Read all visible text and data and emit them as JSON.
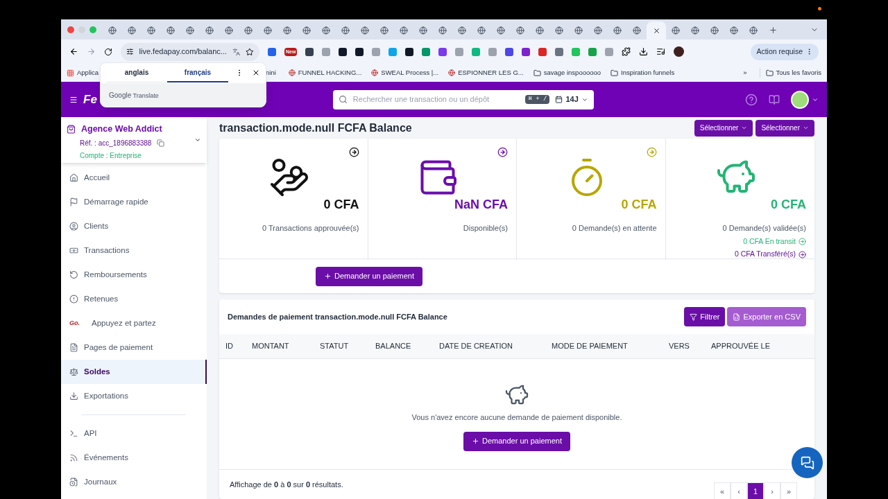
{
  "browser": {
    "tabs": [
      {
        "selected": false
      },
      {
        "selected": false
      },
      {
        "selected": false
      },
      {
        "selected": false
      },
      {
        "selected": false
      },
      {
        "selected": false
      },
      {
        "selected": false
      },
      {
        "selected": false
      },
      {
        "selected": false
      },
      {
        "selected": false
      },
      {
        "selected": false
      },
      {
        "selected": false
      },
      {
        "selected": false
      },
      {
        "selected": false
      },
      {
        "selected": false
      },
      {
        "selected": false
      },
      {
        "selected": false
      },
      {
        "selected": false
      },
      {
        "selected": false
      },
      {
        "selected": false
      },
      {
        "selected": false
      },
      {
        "selected": false
      },
      {
        "selected": false
      },
      {
        "selected": false
      },
      {
        "selected": false
      },
      {
        "selected": false
      },
      {
        "selected": false
      },
      {
        "selected": false
      },
      {
        "selected": true
      },
      {
        "selected": false
      },
      {
        "selected": false
      },
      {
        "selected": false
      },
      {
        "selected": false
      },
      {
        "selected": false
      }
    ],
    "address": "live.fedapay.com/balanc...",
    "extension_badge": "New",
    "action_button": "Action requise",
    "bookmarks": [
      "Applica",
      "nini",
      "FUNNEL HACKING...",
      "SWEAL Process |...",
      "ESPIONNER LES G...",
      "savage inspoooooo",
      "Inspiration funnels"
    ],
    "bookmarks_more": "»",
    "all_bookmarks": "Tous les favoris",
    "translate_popup": {
      "languages": [
        {
          "label": "anglais",
          "selected": false
        },
        {
          "label": "français",
          "selected": true
        }
      ],
      "brand": "Google",
      "product": "Translate"
    }
  },
  "header": {
    "logo_text": "Fe",
    "search_placeholder": "Rechercher une transaction ou un dépôt",
    "shortcut": "⌘ + /",
    "period": "14J"
  },
  "account": {
    "name": "Agence Web Addict",
    "ref": "Réf. : acc_1896883388",
    "type": "Compte : Entreprise"
  },
  "nav": [
    {
      "label": "Accueil",
      "selected": false
    },
    {
      "label": "Démarrage rapide",
      "selected": false
    },
    {
      "label": "Clients",
      "selected": false
    },
    {
      "label": "Transactions",
      "selected": false
    },
    {
      "label": "Remboursements",
      "selected": false
    },
    {
      "label": "Retenues",
      "selected": false
    },
    {
      "label": "Appuyez et partez",
      "logo": "Go.",
      "selected": false
    },
    {
      "label": "Pages de paiement",
      "selected": false
    },
    {
      "label": "Soldes",
      "selected": true
    },
    {
      "label": "Exportations",
      "selected": false
    }
  ],
  "nav_dev": [
    {
      "label": "API",
      "selected": false
    },
    {
      "label": "Événements",
      "selected": false
    },
    {
      "label": "Journaux",
      "selected": false
    }
  ],
  "page": {
    "title": "transaction.mode.null FCFA Balance",
    "selects": [
      "Sélectionner",
      "Sélectionner"
    ],
    "stats": [
      {
        "amount": "0 CFA",
        "caption": "0 Transactions approuvée(s)",
        "color": "#111111"
      },
      {
        "amount": "NaN CFA",
        "caption": "Disponible(s)",
        "color": "#6a0dad"
      },
      {
        "amount": "0 CFA",
        "caption": "0 Demande(s) en attente",
        "color": "#b8a600"
      },
      {
        "amount": "0 CFA",
        "caption": "0 Demande(s) validée(s)",
        "color": "#22b573",
        "links": [
          {
            "text": "0 CFA En transit",
            "color": "#22b573"
          },
          {
            "text": "0 CFA Transféré(s)",
            "color": "#5b0a94"
          }
        ]
      }
    ],
    "request_button": "Demander un paiement"
  },
  "requests": {
    "title": "Demandes de paiement transaction.mode.null FCFA Balance",
    "filter_button": "Filtrer",
    "export_button": "Exporter en CSV",
    "columns": [
      "ID",
      "MONTANT",
      "STATUT",
      "BALANCE",
      "DATE DE CREATION",
      "MODE DE PAIEMENT",
      "VERS",
      "APPROUVÉE LE"
    ],
    "empty_message": "Vous n'avez encore aucune demande de paiement disponible.",
    "empty_button": "Demander un paiement",
    "summary": "Affichage de **0** à **0** sur **0** résultats.",
    "pages": [
      {
        "label": "«",
        "selected": false
      },
      {
        "label": "‹",
        "selected": false
      },
      {
        "label": "1",
        "selected": true
      },
      {
        "label": "›",
        "selected": false
      },
      {
        "label": "»",
        "selected": false
      }
    ]
  }
}
